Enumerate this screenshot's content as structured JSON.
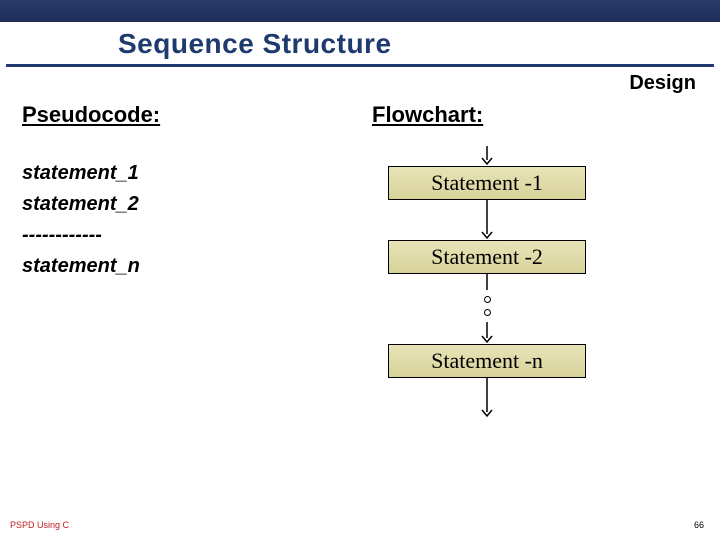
{
  "header": {
    "title": "Sequence Structure",
    "corner_label": "Design"
  },
  "left": {
    "heading": "Pseudocode:",
    "lines": {
      "s1": "statement_1",
      "s2": "statement_2",
      "dashes": "------------",
      "sn": "statement_n"
    }
  },
  "right": {
    "heading": "Flowchart:",
    "boxes": {
      "b1": "Statement -1",
      "b2": "Statement -2",
      "bn": "Statement -n"
    }
  },
  "footer": {
    "left": "PSPD Using C",
    "page": "66"
  },
  "chart_data": {
    "type": "table",
    "title": "Sequence Structure",
    "columns": [
      "Pseudocode",
      "Flowchart"
    ],
    "rows": [
      [
        "statement_1",
        "Statement -1"
      ],
      [
        "statement_2",
        "Statement -2"
      ],
      [
        "------------",
        "…"
      ],
      [
        "statement_n",
        "Statement -n"
      ]
    ],
    "notes": "Flowchart column depicts process boxes connected top-to-bottom by arrows; ellipsis (two small circles) between Statement -2 and Statement -n."
  }
}
